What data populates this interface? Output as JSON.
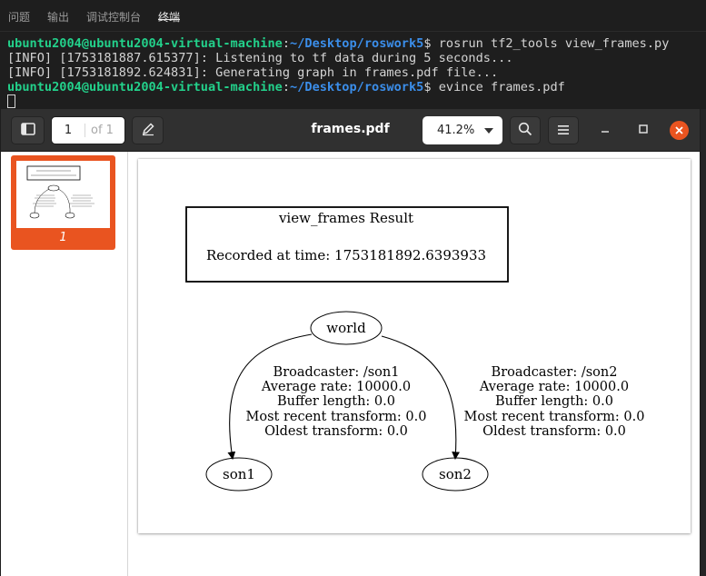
{
  "panel_tabs": [
    "问题",
    "输出",
    "调试控制台",
    "终端"
  ],
  "terminal": {
    "prompt_host": "ubuntu2004@ubuntu2004-virtual-machine",
    "prompt_path": "~/Desktop/roswork5",
    "prompt_symbol": "$",
    "cmd1": " rosrun tf2_tools view_frames.py",
    "info1": "[INFO] [1753181887.615377]: Listening to tf data during 5 seconds...",
    "info2": "[INFO] [1753181892.624831]: Generating graph in frames.pdf file...",
    "cmd2": " evince frames.pdf"
  },
  "viewer": {
    "page_number": "1",
    "page_of": "of 1",
    "title": "frames.pdf",
    "zoom": "41.2%",
    "thumb_label": "1"
  },
  "icons": {
    "sidebar_toggle": "sidebar-icon",
    "annotate": "pencil-icon",
    "search": "search-icon",
    "menu": "hamburger-menu-icon",
    "minimize": "minimize-icon",
    "maximize": "maximize-icon",
    "close": "close-icon"
  },
  "colors": {
    "accent": "#e95420",
    "prompt_host": "#23d18b",
    "prompt_path": "#3b8eea"
  },
  "graph": {
    "title_line1": "view_frames Result",
    "title_line2": "Recorded at time: 1753181892.6393933",
    "nodes": {
      "world": "world",
      "son1": "son1",
      "son2": "son2"
    },
    "edge1": [
      "Broadcaster: /son1",
      "Average rate: 10000.0",
      "Buffer length: 0.0",
      "Most recent transform: 0.0",
      "Oldest transform: 0.0"
    ],
    "edge2": [
      "Broadcaster: /son2",
      "Average rate: 10000.0",
      "Buffer length: 0.0",
      "Most recent transform: 0.0",
      "Oldest transform: 0.0"
    ]
  }
}
